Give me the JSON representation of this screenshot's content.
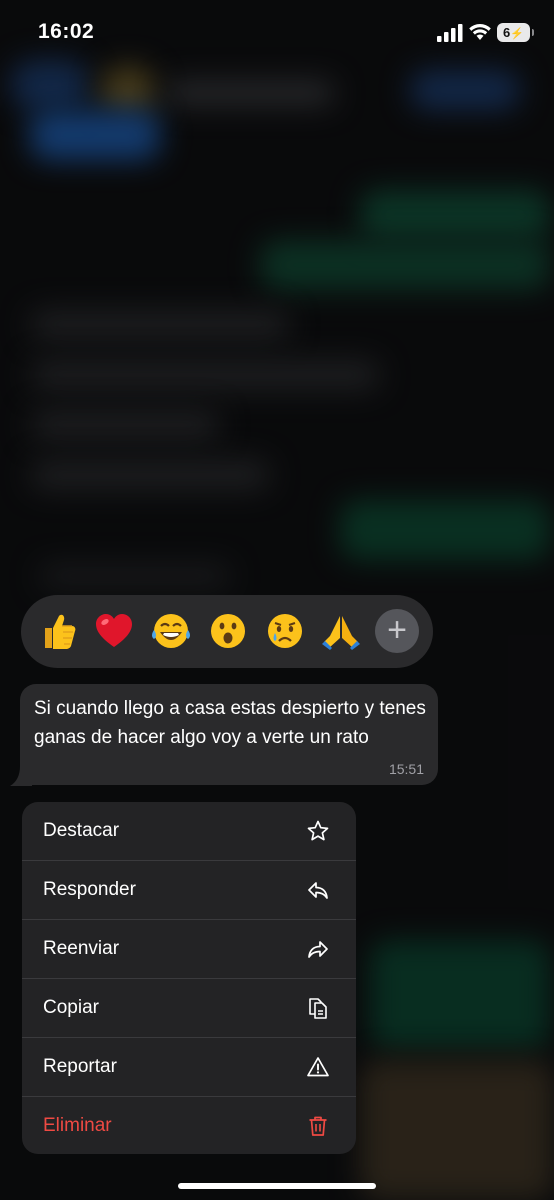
{
  "status_bar": {
    "time": "16:02",
    "battery": "6"
  },
  "reactions": {
    "emojis": [
      {
        "name": "thumbs-up",
        "glyph": "👍"
      },
      {
        "name": "red-heart",
        "glyph": "❤️"
      },
      {
        "name": "tears-of-joy",
        "glyph": "😂"
      },
      {
        "name": "surprised",
        "glyph": "😮"
      },
      {
        "name": "crying",
        "glyph": "😢"
      },
      {
        "name": "folded-hands",
        "glyph": "🙏"
      }
    ],
    "more_label": "+"
  },
  "message": {
    "text": "Si cuando llego a casa estas despierto y tenes ganas de hacer algo voy a verte un rato",
    "time": "15:51"
  },
  "menu": {
    "items": [
      {
        "label": "Destacar",
        "icon": "star-icon"
      },
      {
        "label": "Responder",
        "icon": "reply-icon"
      },
      {
        "label": "Reenviar",
        "icon": "forward-icon"
      },
      {
        "label": "Copiar",
        "icon": "copy-icon"
      },
      {
        "label": "Reportar",
        "icon": "warning-icon"
      },
      {
        "label": "Eliminar",
        "icon": "trash-icon"
      }
    ]
  },
  "colors": {
    "danger": "#ef4a43",
    "bubble": "#2a2a2c",
    "menu": "#232325"
  }
}
